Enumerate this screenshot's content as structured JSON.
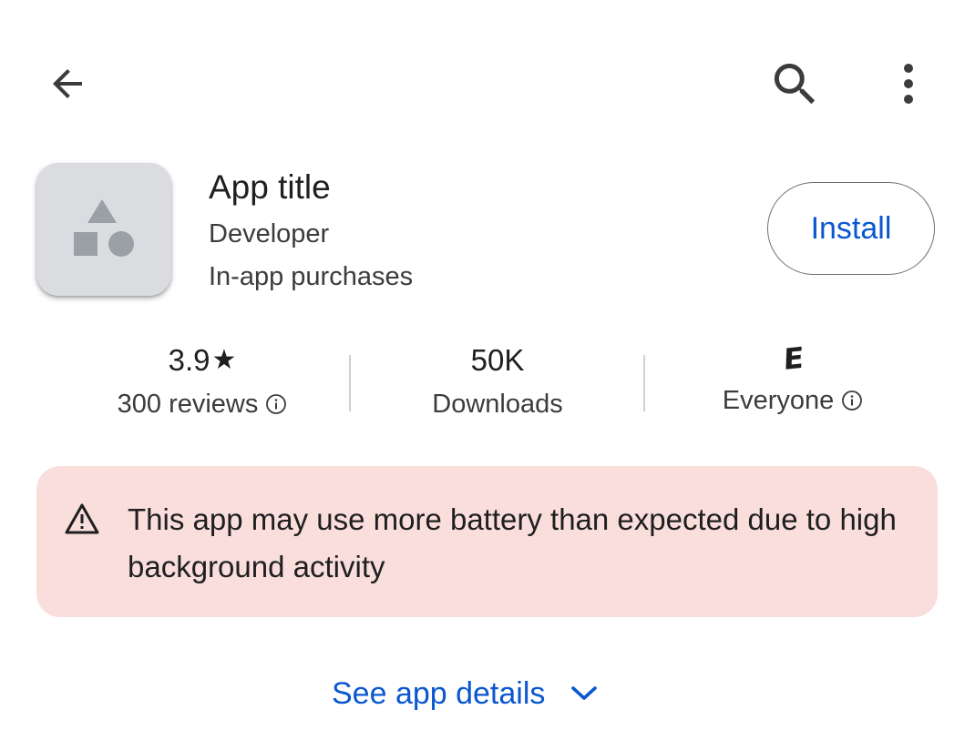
{
  "top_bar": {
    "back_icon": "arrow-back-icon",
    "search_icon": "search-icon",
    "more_icon": "more-vert-icon"
  },
  "app": {
    "icon": "app-placeholder-icon",
    "title": "App title",
    "developer": "Developer",
    "purchases": "In-app purchases",
    "install_label": "Install"
  },
  "stats": {
    "rating_value": "3.9",
    "rating_star": "★",
    "reviews_label": "300 reviews",
    "downloads_value": "50K",
    "downloads_label": "Downloads",
    "content_rating_badge": "E",
    "content_rating_label": "Everyone",
    "info_icon": "info-icon"
  },
  "warning": {
    "icon": "warning-triangle-icon",
    "text": "This app may use more battery than expected due to high background activity"
  },
  "details": {
    "label": "See app details",
    "icon": "chevron-down-icon"
  },
  "colors": {
    "accent": "#0b57d0",
    "warning_bg": "#f9dedc",
    "icon_bg": "#dadce0",
    "icon_fg": "#9aa0a6"
  }
}
